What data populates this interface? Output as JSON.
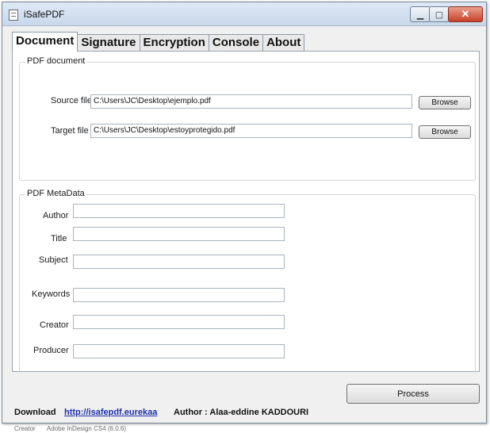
{
  "window": {
    "title": "iSafePDF",
    "controls": {
      "minimize": "▁",
      "maximize": "▢",
      "close": "✕"
    }
  },
  "tabs": [
    {
      "label": "Document",
      "active": true
    },
    {
      "label": "Signature",
      "active": false
    },
    {
      "label": "Encryption",
      "active": false
    },
    {
      "label": "Console",
      "active": false
    },
    {
      "label": "About",
      "active": false
    }
  ],
  "pdf_document": {
    "group_title": "PDF document",
    "source_label": "Source file",
    "source_value": "C:\\Users\\JC\\Desktop\\ejemplo.pdf",
    "target_label": "Target file",
    "target_value": "C:\\Users\\JC\\Desktop\\estoyprotegido.pdf",
    "browse_label": "Browse"
  },
  "metadata": {
    "group_title": "PDF MetaData",
    "fields": [
      {
        "label": "Author",
        "value": ""
      },
      {
        "label": "Title",
        "value": ""
      },
      {
        "label": "Subject",
        "value": ""
      },
      {
        "label": "Keywords",
        "value": ""
      },
      {
        "label": "Creator",
        "value": ""
      },
      {
        "label": "Producer",
        "value": ""
      }
    ]
  },
  "actions": {
    "process_label": "Process"
  },
  "footer": {
    "download_label": "Download",
    "link_text": "http://isafepdf.eurekaa",
    "author_text": "Author : Alaa-eddine KADDOURI"
  },
  "below_window": {
    "creator_label": "Creator",
    "creator_value": "Adobe InDesign CS4 (6.0.6)"
  },
  "colors": {
    "titlebar": "#c8d7ea",
    "close_button": "#c8412a",
    "link": "#1b2fa8",
    "panel": "#ffffff",
    "window_bg": "#f0f0f0"
  }
}
